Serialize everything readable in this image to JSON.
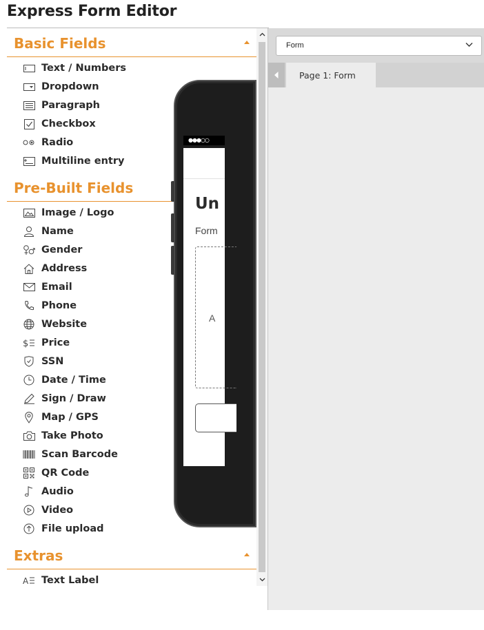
{
  "app": {
    "title": "Express Form Editor"
  },
  "sections": [
    {
      "title": "Basic Fields",
      "items": [
        {
          "label": "Text / Numbers",
          "icon": "text-field-icon"
        },
        {
          "label": "Dropdown",
          "icon": "dropdown-icon"
        },
        {
          "label": "Paragraph",
          "icon": "paragraph-icon"
        },
        {
          "label": "Checkbox",
          "icon": "checkbox-icon"
        },
        {
          "label": "Radio",
          "icon": "radio-icon"
        },
        {
          "label": "Multiline entry",
          "icon": "multiline-icon"
        }
      ]
    },
    {
      "title": "Pre-Built Fields",
      "items": [
        {
          "label": "Image / Logo",
          "icon": "image-icon"
        },
        {
          "label": "Name",
          "icon": "person-icon"
        },
        {
          "label": "Gender",
          "icon": "gender-icon"
        },
        {
          "label": "Address",
          "icon": "home-icon"
        },
        {
          "label": "Email",
          "icon": "envelope-icon"
        },
        {
          "label": "Phone",
          "icon": "phone-icon"
        },
        {
          "label": "Website",
          "icon": "globe-icon"
        },
        {
          "label": "Price",
          "icon": "price-icon"
        },
        {
          "label": "SSN",
          "icon": "shield-icon"
        },
        {
          "label": "Date / Time",
          "icon": "clock-icon"
        },
        {
          "label": "Sign / Draw",
          "icon": "pen-icon"
        },
        {
          "label": "Map / GPS",
          "icon": "map-pin-icon"
        },
        {
          "label": "Take Photo",
          "icon": "camera-icon"
        },
        {
          "label": "Scan Barcode",
          "icon": "barcode-icon"
        },
        {
          "label": "QR Code",
          "icon": "qr-code-icon"
        },
        {
          "label": "Audio",
          "icon": "music-note-icon"
        },
        {
          "label": "Video",
          "icon": "play-icon"
        },
        {
          "label": "File upload",
          "icon": "upload-icon"
        }
      ]
    },
    {
      "title": "Extras",
      "items": [
        {
          "label": "Text Label",
          "icon": "text-label-icon"
        }
      ]
    }
  ],
  "toolbar": {
    "form_select_value": "Form"
  },
  "tabs": {
    "active_label": "Page 1: Form"
  },
  "preview": {
    "status_signal": "●●●○○",
    "heading": "Un",
    "subtitle": "Form",
    "drop_hint": "A"
  },
  "colors": {
    "accent": "#e8922e"
  }
}
